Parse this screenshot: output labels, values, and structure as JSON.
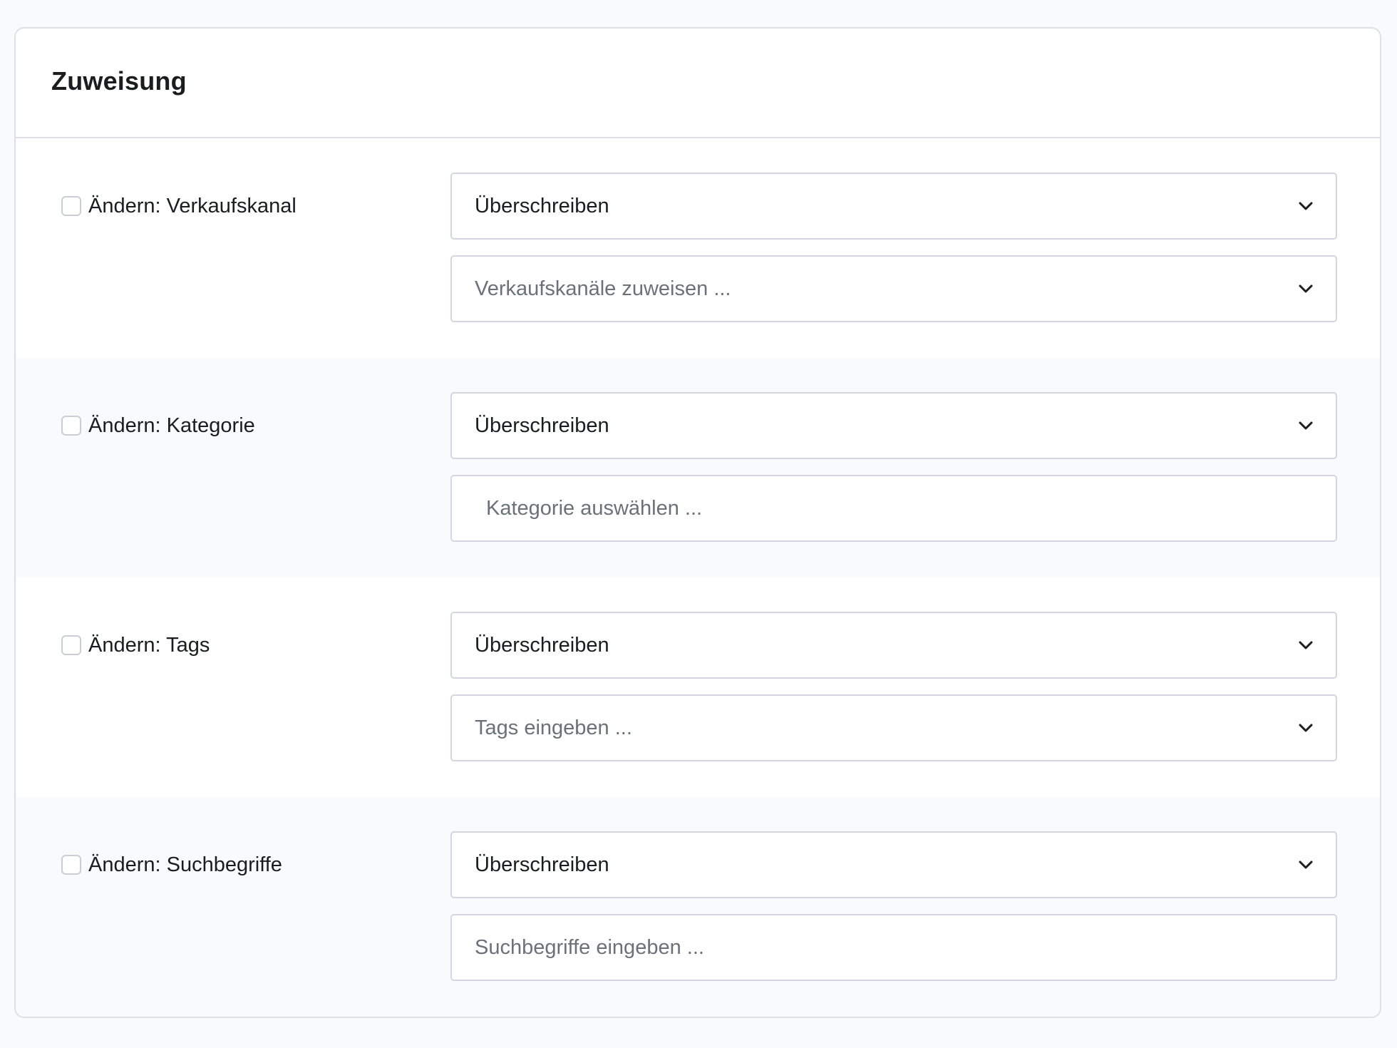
{
  "card": {
    "title": "Zuweisung"
  },
  "rows": [
    {
      "label": "Ändern: Verkaufskanal",
      "mode_value": "Überschreiben",
      "secondary_placeholder": "Verkaufskanäle zuweisen ...",
      "secondary_type": "select"
    },
    {
      "label": "Ändern: Kategorie",
      "mode_value": "Überschreiben",
      "secondary_placeholder": "Kategorie auswählen ...",
      "secondary_type": "input"
    },
    {
      "label": "Ändern: Tags",
      "mode_value": "Überschreiben",
      "secondary_placeholder": "Tags eingeben ...",
      "secondary_type": "select"
    },
    {
      "label": "Ändern: Suchbegriffe",
      "mode_value": "Überschreiben",
      "secondary_placeholder": "Suchbegriffe eingeben ...",
      "secondary_type": "input"
    }
  ],
  "icons": {
    "dropdown": "chevron-down-icon"
  },
  "colors": {
    "page_background": "#f8fafc",
    "card_background": "#ffffff",
    "alt_row_background": "#f9fafc",
    "border": "#d3d7dd",
    "text": "#1a1d1f",
    "placeholder": "#6b7178"
  }
}
